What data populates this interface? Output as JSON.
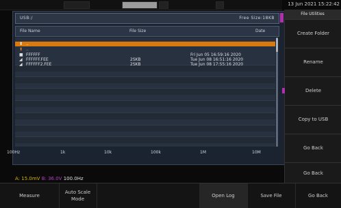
{
  "top": {
    "clock": "13 Jun 2021 15:22:42"
  },
  "browser": {
    "path": "USB:/",
    "usage": "Free Size:18KB",
    "headers": {
      "name": "File Name",
      "size": "File Size",
      "date": "Date"
    },
    "files": [
      {
        "name": "..",
        "size": "",
        "date": "",
        "type": "up"
      },
      {
        "name": "..",
        "size": "",
        "date": "",
        "type": "up"
      },
      {
        "name": "FFFFFF",
        "size": "",
        "date": "Fri Jun 05 16:59:16 2020",
        "type": "folder"
      },
      {
        "name": "FFFFFF.FEE",
        "size": "2SKB",
        "date": "Tue Jun 08 16:51:16 2020",
        "type": "file"
      },
      {
        "name": "FFFFFF2.FEE",
        "size": "2SKB",
        "date": "Tue Jun 08 17:55:16 2020",
        "type": "file"
      }
    ],
    "scale": [
      "100Hz",
      "1k",
      "10k",
      "100k",
      "1M",
      "10M"
    ]
  },
  "status": {
    "a": "A: 15.0mV",
    "b": "B: 36.0V",
    "c": "100.0Hz"
  },
  "side_menu": {
    "title": "File Utilities",
    "buttons": [
      {
        "label": "Create Folder"
      },
      {
        "label": "Rename"
      },
      {
        "label": "Delete"
      },
      {
        "label": "Copy to USB"
      },
      {
        "label": "Go Back"
      },
      {
        "label": "Go Back"
      }
    ]
  },
  "bottom_softkeys": [
    {
      "label": "Measure"
    },
    {
      "label": "Auto Scale Mode"
    },
    {
      "label": "Open Log"
    },
    {
      "label": "Save File"
    },
    {
      "label": "Go Back"
    }
  ]
}
